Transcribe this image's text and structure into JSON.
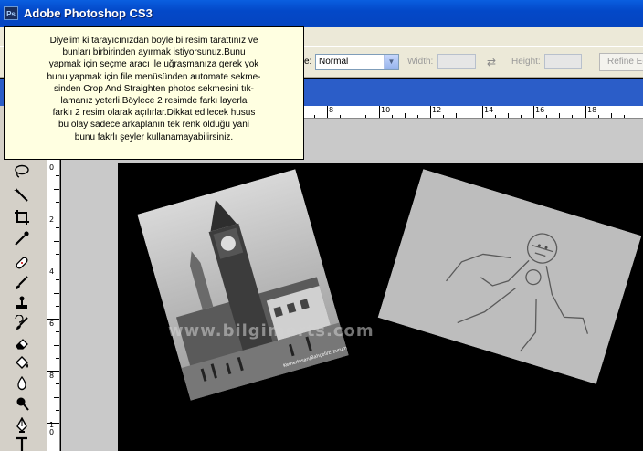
{
  "window": {
    "title": "Adobe Photoshop CS3",
    "app_icon_text": "Ps"
  },
  "options_bar": {
    "style_label": "e:",
    "style_value": "Normal",
    "width_label": "Width:",
    "height_label": "Height:",
    "refine_label": "Refine Ed"
  },
  "rulers": {
    "horizontal_ticks": [
      "8",
      "10",
      "12",
      "14",
      "16",
      "18"
    ],
    "vertical_ticks": [
      "0",
      "2",
      "4",
      "6",
      "8",
      "1\n0"
    ]
  },
  "watermark": "www.bilgimerts.com",
  "photo1_caption": "Kemerhisarı/Bahçeli/Erzurum",
  "tooltip": {
    "lines": [
      "Diyelim ki tarayıcınızdan böyle bi resim tarattınız ve",
      "bunları birbirinden ayırmak istiyorsunuz.Bunu",
      "yapmak için seçme aracı ile uğraşmanıza gerek yok",
      "bunu yapmak için file menüsünden automate sekme-",
      "sinden Crop And Straighten photos sekmesini tık-",
      "lamanız yeterli.Böylece 2 resimde farkı layerla",
      "farklı 2 resim olarak açılırlar.Dikkat edilecek husus",
      "bu olay sadece arkaplanın tek renk olduğu yani",
      "bunu fakrlı şeyler kullanamayabilirsiniz."
    ]
  },
  "tools": [
    "lasso-tool",
    "magic-wand-tool",
    "crop-tool",
    "eyedropper-tool",
    "healing-brush-tool",
    "brush-tool",
    "clone-stamp-tool",
    "history-brush-tool",
    "eraser-tool",
    "paint-bucket-tool",
    "blur-tool",
    "dodge-tool",
    "pen-tool",
    "type-tool"
  ]
}
